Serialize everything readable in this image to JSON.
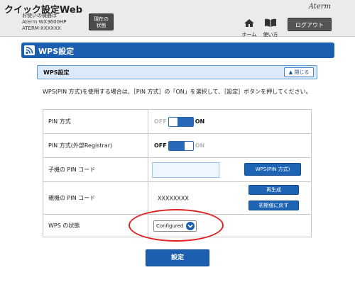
{
  "header": {
    "title": "クイック設定Web",
    "model_line1": "お使いの機器は",
    "model_line2": "Aterm WX3600HP",
    "model_line3": "ATERM-XXXXXX",
    "status_label_1": "現在の",
    "status_label_2": "状態",
    "brand": "Aterm",
    "home_label": "ホーム",
    "guide_label": "使い方",
    "logout_label": "ログアウト"
  },
  "section": {
    "title": "WPS設定"
  },
  "panel": {
    "title": "WPS設定",
    "close_label": "閉じる"
  },
  "description": "WPS(PIN 方式)を使用する場合は、［PIN 方式］の「ON」を選択して、［設定］ボタンを押してください。",
  "rows": {
    "pin_mode": {
      "label": "PIN 方式",
      "off": "OFF",
      "on": "ON",
      "state": "ON"
    },
    "pin_external": {
      "label": "PIN 方式(外部Registrar)",
      "off": "OFF",
      "on": "ON",
      "state": "OFF"
    },
    "child_pin": {
      "label": "子機の PIN コード",
      "value": "",
      "button": "WPS(PIN 方式)"
    },
    "parent_pin": {
      "label": "親機の PIN コード",
      "value": "XXXXXXXX",
      "regenerate": "再生成",
      "reset": "初期値に戻す"
    },
    "wps_state": {
      "label": "WPS の状態",
      "selected": "Configured"
    }
  },
  "submit_label": "設定",
  "colors": {
    "primary": "#1c5fb0",
    "highlight_ring": "#e02020"
  },
  "icons": [
    "home-icon",
    "book-icon",
    "wifi-icon",
    "chevron-up-icon",
    "chevron-down-icon"
  ]
}
